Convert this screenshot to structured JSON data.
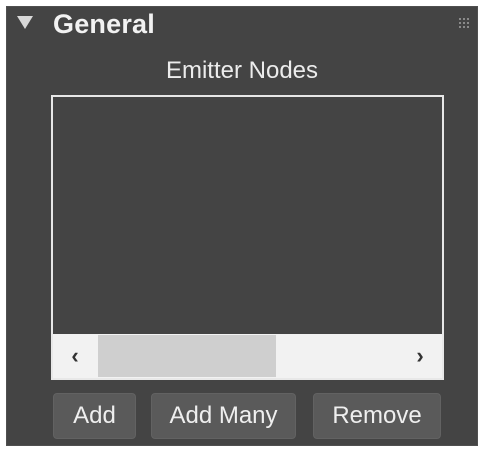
{
  "rollout": {
    "title": "General"
  },
  "emitter_nodes": {
    "label": "Emitter Nodes",
    "items": [],
    "scrollbar": {
      "left_arrow": "‹",
      "right_arrow": "›"
    }
  },
  "buttons": {
    "add": "Add",
    "add_many": "Add Many",
    "remove": "Remove"
  },
  "icons": {
    "collapse": "triangle-down-icon",
    "grip": "drag-grip-icon"
  }
}
